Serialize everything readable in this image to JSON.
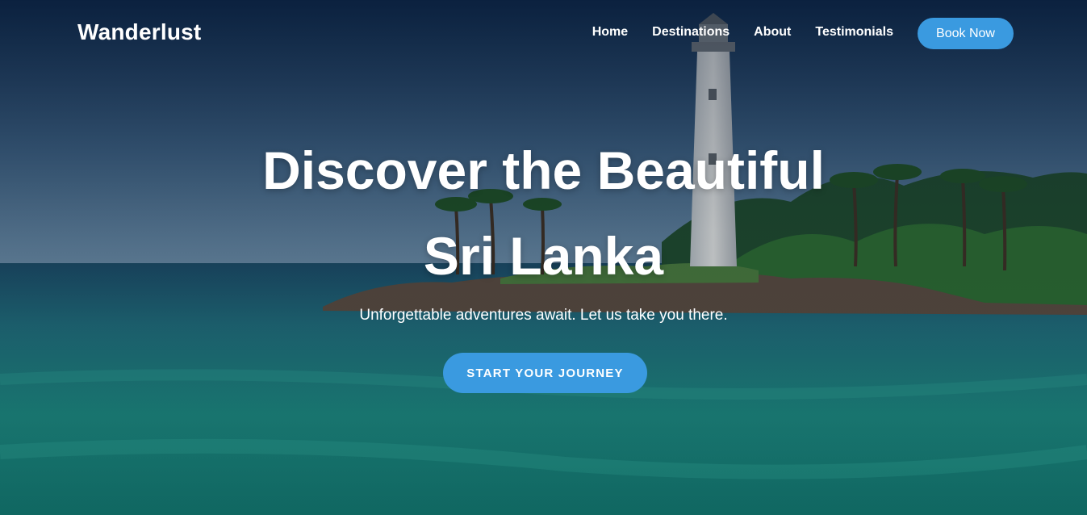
{
  "brand": {
    "name": "Wanderlust"
  },
  "nav": {
    "links": [
      "Home",
      "Destinations",
      "About",
      "Testimonials"
    ],
    "cta_label": "Book Now"
  },
  "hero": {
    "title_line1": "Discover the Beautiful",
    "title_line2": "Sri Lanka",
    "subtitle": "Unforgettable adventures await. Let us take you there.",
    "cta_label": "START YOUR JOURNEY"
  },
  "colors": {
    "accent": "#3a9ae0",
    "text": "#ffffff"
  }
}
